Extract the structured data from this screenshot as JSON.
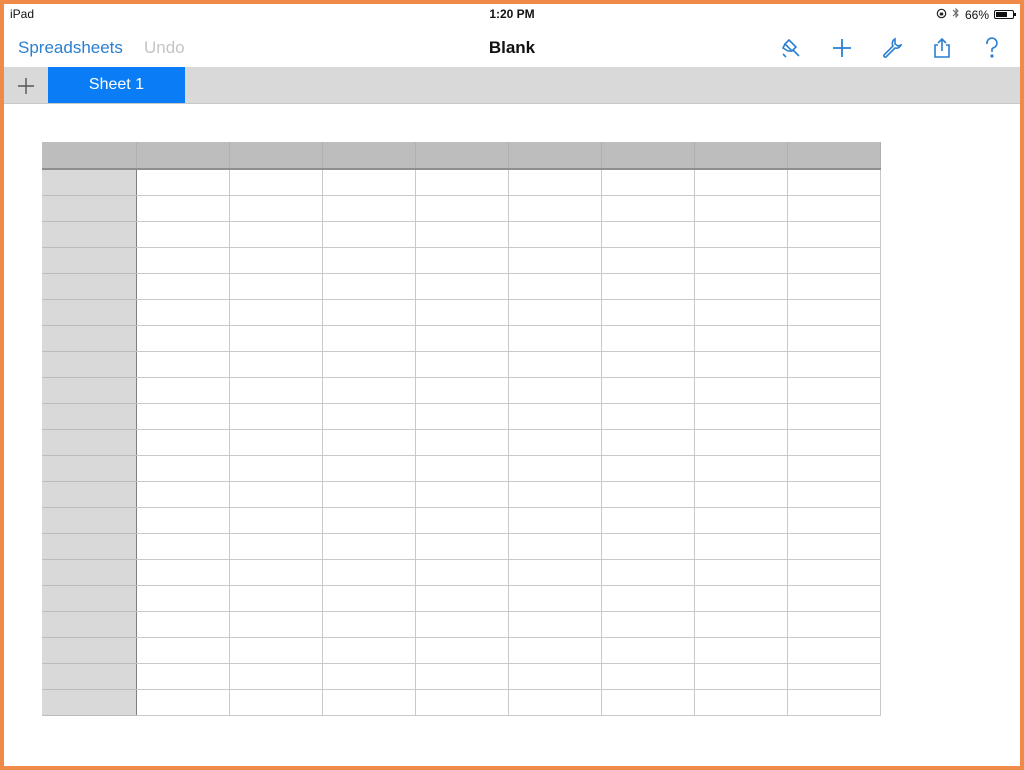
{
  "status_bar": {
    "device": "iPad",
    "time": "1:20 PM",
    "battery_percent_label": "66%",
    "battery_level": 0.66,
    "icons": [
      "rotation-lock-icon",
      "bluetooth-icon",
      "battery-icon"
    ]
  },
  "nav": {
    "back_label": "Spreadsheets",
    "undo_label": "Undo",
    "title": "Blank",
    "actions": [
      {
        "name": "format-brush-icon",
        "label": "Format"
      },
      {
        "name": "plus-icon",
        "label": "Add"
      },
      {
        "name": "wrench-icon",
        "label": "Tools"
      },
      {
        "name": "share-icon",
        "label": "Share"
      },
      {
        "name": "help-icon",
        "label": "?"
      }
    ]
  },
  "tabs": {
    "add_label": "+",
    "sheets": [
      {
        "label": "Sheet 1",
        "active": true
      }
    ]
  },
  "grid": {
    "columns": 9,
    "header_rows": 1,
    "body_rows": 21,
    "header_column_count": 1,
    "cells_empty": true
  }
}
